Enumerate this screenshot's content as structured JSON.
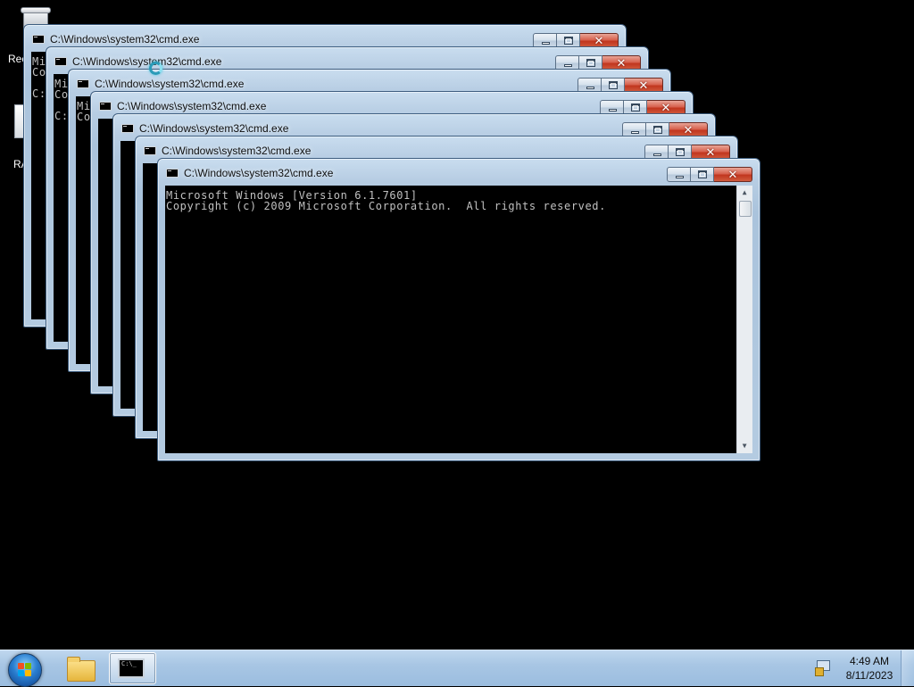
{
  "desktop": {
    "icons": [
      {
        "label": "Rec"
      },
      {
        "label": "RA"
      }
    ]
  },
  "window_title": "C:\\Windows\\system32\\cmd.exe",
  "console_lines": [
    "Microsoft Windows [Version 6.1.7601]",
    "Copyright (c) 2009 Microsoft Corporation.  All rights reserved."
  ],
  "partial_text": {
    "mi": "Mi",
    "co": "Co",
    "prompt": "C:"
  },
  "caption_glyphs": {
    "close": "✕"
  },
  "taskbar": {
    "clock_time": "4:49 AM",
    "clock_date": "8/11/2023",
    "cmd_thumb_text": "C:\\_"
  },
  "colors": {
    "glass": "#b7cde3",
    "close_red": "#c1361f",
    "console_bg": "#000000",
    "console_fg": "#c0c0c0",
    "taskbar": "#a8c6e4"
  },
  "icons": [
    "recycle-bin-icon",
    "busy-cursor-icon",
    "start-orb-icon",
    "folder-icon",
    "cmd-icon",
    "action-center-icon"
  ]
}
